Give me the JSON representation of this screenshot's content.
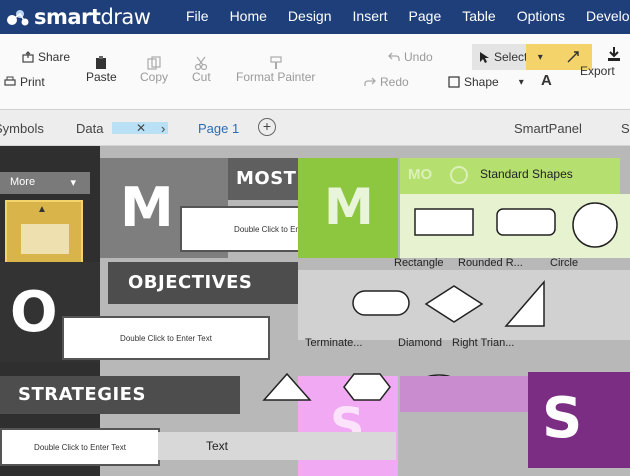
{
  "app": {
    "logo_text_bold": "smart",
    "logo_text_light": "draw"
  },
  "menu": [
    "File",
    "Home",
    "Design",
    "Insert",
    "Page",
    "Table",
    "Options",
    "Develo"
  ],
  "ribbon": {
    "share": "Share",
    "print": "Print",
    "paste": "Paste",
    "copy": "Copy",
    "cut": "Cut",
    "format_painter": "Format Painter",
    "undo": "Undo",
    "redo": "Redo",
    "select": "Select",
    "shape": "Shape",
    "export": "Export",
    "text_a": "A"
  },
  "tabs": {
    "symbols": "Symbols",
    "data": "Data",
    "page": "Page 1",
    "smartpanel": "SmartPanel",
    "s_cut": "S"
  },
  "left_panel": {
    "more": "More"
  },
  "canvas": {
    "most_title": "MOST",
    "m_letter": "M",
    "objectives_title": "OBJECTIVES",
    "o_letter": "O",
    "strategies_title": "STRATEGIES",
    "s_letter": "S",
    "double_click": "Double Click to Enter Text"
  },
  "shapes_panel": {
    "title": "Standard Shapes",
    "labels": [
      "Rectangle",
      "Rounded R...",
      "Circle",
      "Terminate...",
      "Diamond",
      "Right Trian..."
    ],
    "text_item": "Text"
  },
  "colors": {
    "topbar": "#1e3f7a",
    "green": "#8dc63f",
    "purple": "#7a2d82",
    "gold": "#d9b44a",
    "highlight_yellow": "#f4d46a"
  }
}
